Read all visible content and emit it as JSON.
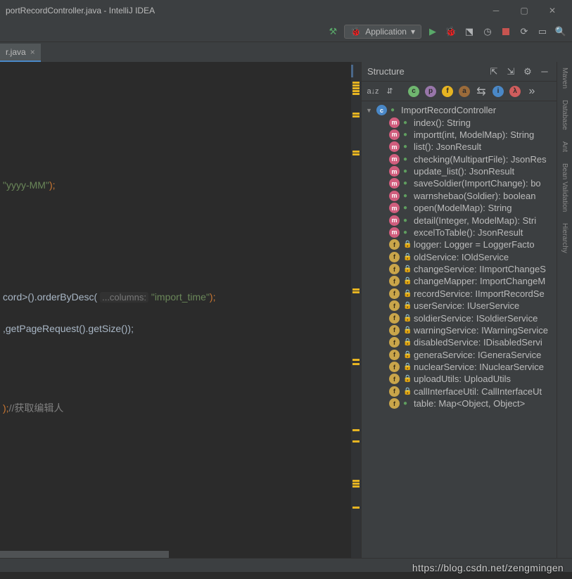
{
  "window": {
    "title": "portRecordController.java - IntelliJ IDEA"
  },
  "toolbar": {
    "run_config": "Application"
  },
  "tabs": {
    "t0": {
      "label": "r.java"
    }
  },
  "code": {
    "l1_str": "\"yyyy-MM\"",
    "l1_end": ");",
    "l2_a": "cord>().orderByDesc( ",
    "l2_hint": "...columns:",
    "l2_str": " \"import_time\"",
    "l2_end": ");",
    "l3_a": ",getPageRequest().getSize());",
    "l4_a": ");",
    "l4_comment": "//获取编辑人"
  },
  "structure": {
    "title": "Structure",
    "root": "ImportRecordController",
    "items": [
      {
        "kind": "m",
        "vis": "pub",
        "label": "index(): String"
      },
      {
        "kind": "m",
        "vis": "pub",
        "label": "importt(int, ModelMap): String"
      },
      {
        "kind": "m",
        "vis": "pub",
        "label": "list(): JsonResult"
      },
      {
        "kind": "m",
        "vis": "pub",
        "label": "checking(MultipartFile): JsonRes"
      },
      {
        "kind": "m",
        "vis": "pub",
        "label": "update_list(): JsonResult"
      },
      {
        "kind": "m",
        "vis": "pub",
        "label": "saveSoldier(ImportChange): bo"
      },
      {
        "kind": "m",
        "vis": "pub",
        "label": "warnshebao(Soldier): boolean"
      },
      {
        "kind": "m",
        "vis": "pub",
        "label": "open(ModelMap): String"
      },
      {
        "kind": "m",
        "vis": "pub",
        "label": "detail(Integer, ModelMap): Stri"
      },
      {
        "kind": "m",
        "vis": "pub",
        "label": "excelToTable(): JsonResult"
      },
      {
        "kind": "f",
        "vis": "priv",
        "label": "logger: Logger = LoggerFacto"
      },
      {
        "kind": "f",
        "vis": "priv",
        "label": "oldService: IOldService"
      },
      {
        "kind": "f",
        "vis": "priv",
        "label": "changeService: IImportChangeS"
      },
      {
        "kind": "f",
        "vis": "priv",
        "label": "changeMapper: ImportChangeM"
      },
      {
        "kind": "f",
        "vis": "priv",
        "label": "recordService: IImportRecordSe"
      },
      {
        "kind": "f",
        "vis": "priv",
        "label": "userService: IUserService"
      },
      {
        "kind": "f",
        "vis": "priv",
        "label": "soldierService: ISoldierService"
      },
      {
        "kind": "f",
        "vis": "priv",
        "label": "warningService: IWarningService"
      },
      {
        "kind": "f",
        "vis": "priv",
        "label": "disabledService: IDisabledServi"
      },
      {
        "kind": "f",
        "vis": "priv",
        "label": "generaService: IGeneraService"
      },
      {
        "kind": "f",
        "vis": "priv",
        "label": "nuclearService: INuclearService"
      },
      {
        "kind": "f",
        "vis": "priv",
        "label": "uploadUtils: UploadUtils"
      },
      {
        "kind": "f",
        "vis": "priv",
        "label": "callInterfaceUtil: CallInterfaceUt"
      },
      {
        "kind": "f",
        "vis": "pub",
        "label": "table: Map<Object, Object>"
      }
    ]
  },
  "right_toolwins": [
    "Maven",
    "Database",
    "Ant",
    "Bean Validation",
    "Hierarchy"
  ],
  "watermark": "https://blog.csdn.net/zengmingen"
}
